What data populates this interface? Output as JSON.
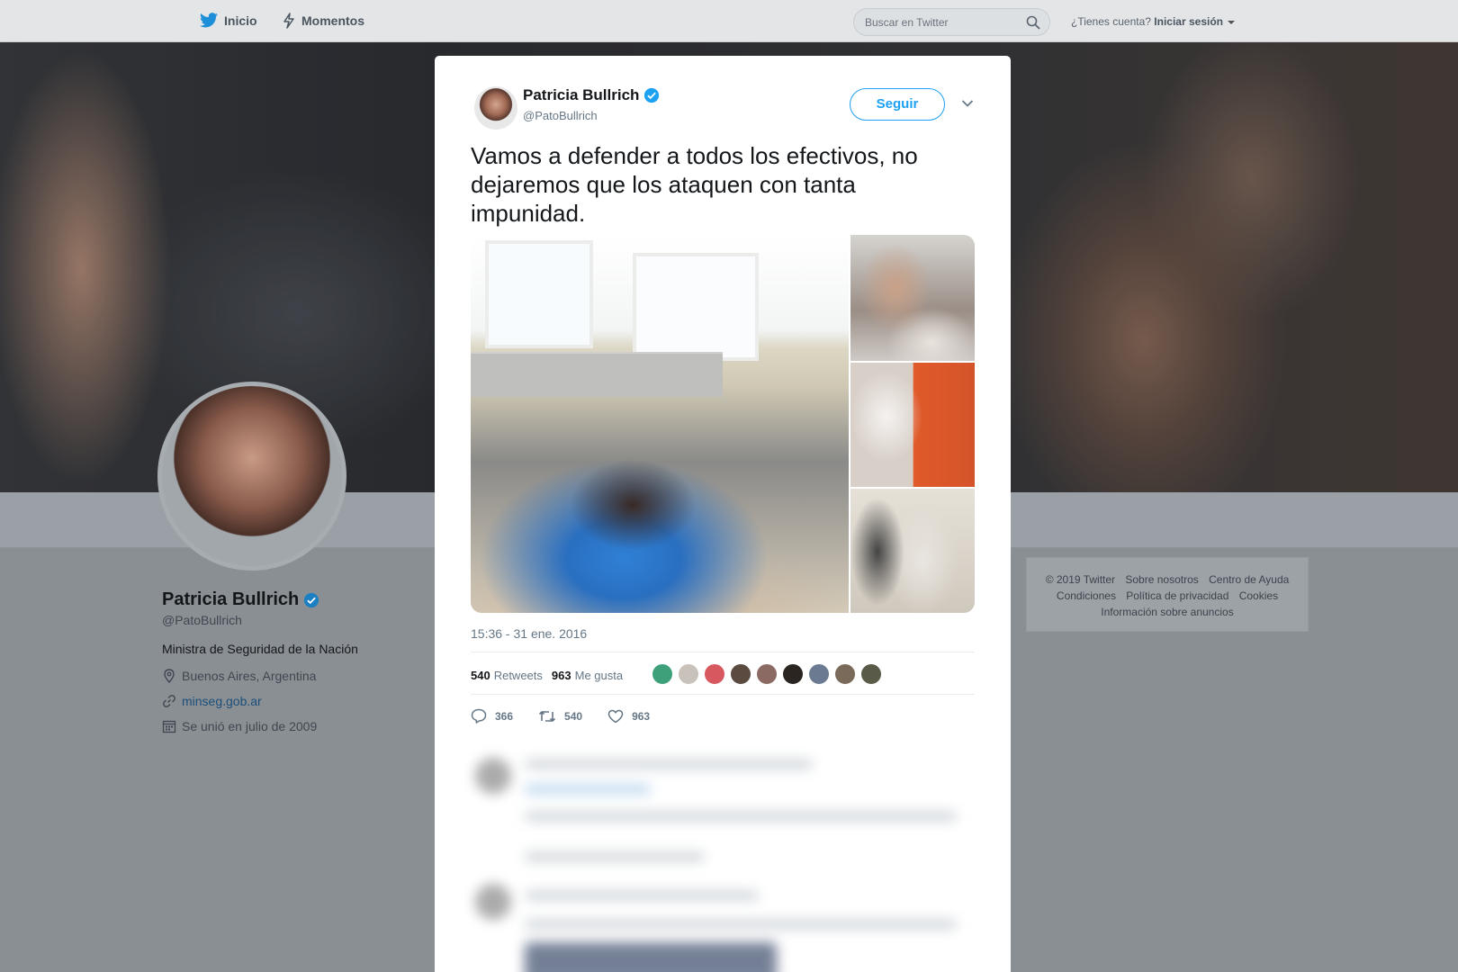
{
  "nav": {
    "home_label": "Inicio",
    "moments_label": "Momentos",
    "search_placeholder": "Buscar en Twitter",
    "account_question": "¿Tienes cuenta?",
    "login_label": "Iniciar sesión"
  },
  "profile": {
    "name": "Patricia Bullrich",
    "handle": "@PatoBullrich",
    "bio": "Ministra de Seguridad de la Nación",
    "location": "Buenos Aires, Argentina",
    "website": "minseg.gob.ar",
    "joined": "Se unió en julio de 2009"
  },
  "footer": {
    "row1": [
      "© 2019 Twitter",
      "Sobre nosotros",
      "Centro de Ayuda"
    ],
    "row2": [
      "Condiciones",
      "Política de privacidad",
      "Cookies"
    ],
    "row3": [
      "Información sobre anuncios"
    ]
  },
  "tweet": {
    "name": "Patricia Bullrich",
    "handle": "@PatoBullrich",
    "follow_label": "Seguir",
    "text": "Vamos a defender a todos los efectivos, no dejaremos que los ataquen con tanta impunidad.",
    "timestamp": "15:36 - 31 ene. 2016",
    "retweets_count": "540",
    "retweets_label": "Retweets",
    "likes_count": "963",
    "likes_label": "Me gusta",
    "reply_count": "366",
    "retweet_count": "540",
    "like_count": "963"
  },
  "colors": {
    "accent": "#1da1f2",
    "verified": "#1da1f2"
  }
}
